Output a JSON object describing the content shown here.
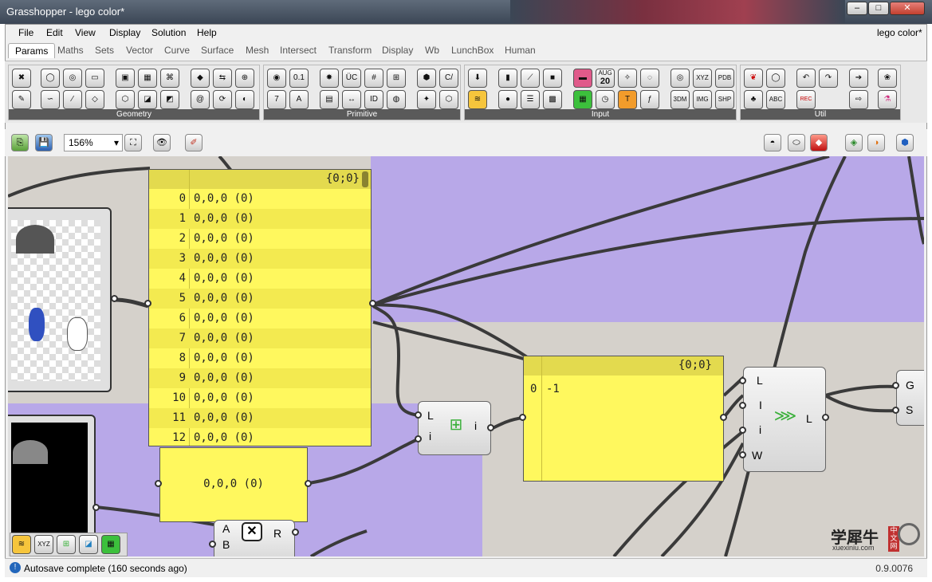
{
  "window": {
    "title": "Grasshopper - lego color*",
    "doc_name": "lego color*",
    "buttons": {
      "minimize": "–",
      "maximize": "□",
      "close": "✕"
    }
  },
  "menu": [
    "File",
    "Edit",
    "View",
    "Display",
    "Solution",
    "Help"
  ],
  "tabs": [
    "Params",
    "Maths",
    "Sets",
    "Vector",
    "Curve",
    "Surface",
    "Mesh",
    "Intersect",
    "Transform",
    "Display",
    "Wb",
    "LunchBox",
    "Human"
  ],
  "ribbon": {
    "groups": [
      "Geometry",
      "Primitive",
      "Input",
      "Util"
    ],
    "icon_text": {
      "prim_a": "0.1",
      "prim_b": "ÜC",
      "prim_c": "C/",
      "prim_d": "7",
      "prim_e": "A",
      "prim_f": "ID",
      "input_date_month": "AUG",
      "input_date_day": "20",
      "util_xyz": "XYZ",
      "util_pdb": "PDB",
      "util_3dm": "3DM",
      "util_img": "IMG",
      "util_shp": "SHP",
      "util_abc": "ABC",
      "util_rec": "REC"
    }
  },
  "toolbar": {
    "zoom": "156%"
  },
  "canvas": {
    "list_panel": {
      "path": "{0;0}",
      "rows": [
        {
          "i": "0",
          "v": "0,0,0 (0)"
        },
        {
          "i": "1",
          "v": "0,0,0 (0)"
        },
        {
          "i": "2",
          "v": "0,0,0 (0)"
        },
        {
          "i": "3",
          "v": "0,0,0 (0)"
        },
        {
          "i": "4",
          "v": "0,0,0 (0)"
        },
        {
          "i": "5",
          "v": "0,0,0 (0)"
        },
        {
          "i": "6",
          "v": "0,0,0 (0)"
        },
        {
          "i": "7",
          "v": "0,0,0 (0)"
        },
        {
          "i": "8",
          "v": "0,0,0 (0)"
        },
        {
          "i": "9",
          "v": "0,0,0 (0)"
        },
        {
          "i": "10",
          "v": "0,0,0 (0)"
        },
        {
          "i": "11",
          "v": "0,0,0 (0)"
        },
        {
          "i": "12",
          "v": "0,0,0 (0)"
        }
      ]
    },
    "single_panel": {
      "value": "0,0,0 (0)"
    },
    "index_panel": {
      "path": "{0;0}",
      "row_index": "0",
      "row_value": "-1"
    },
    "member_index": {
      "inputs": [
        "L",
        "i"
      ],
      "output": "i"
    },
    "replace_items": {
      "inputs": [
        "L",
        "I",
        "i",
        "W"
      ],
      "output": "L"
    },
    "xor_comp": {
      "inputs": [
        "A",
        "B"
      ],
      "output": "R"
    },
    "right_comp": {
      "inputs": [
        "G",
        "S"
      ]
    }
  },
  "status": {
    "message": "Autosave complete (160 seconds ago)",
    "version": "0.9.0076"
  },
  "watermark": {
    "text": "学犀牛",
    "sub": "xuexiniu.com",
    "badge": "中文网"
  },
  "colors": {
    "panel_yellow": "#fff85e",
    "canvas_gray": "#d5d1cb",
    "group_purple": "#b8a8e8"
  }
}
